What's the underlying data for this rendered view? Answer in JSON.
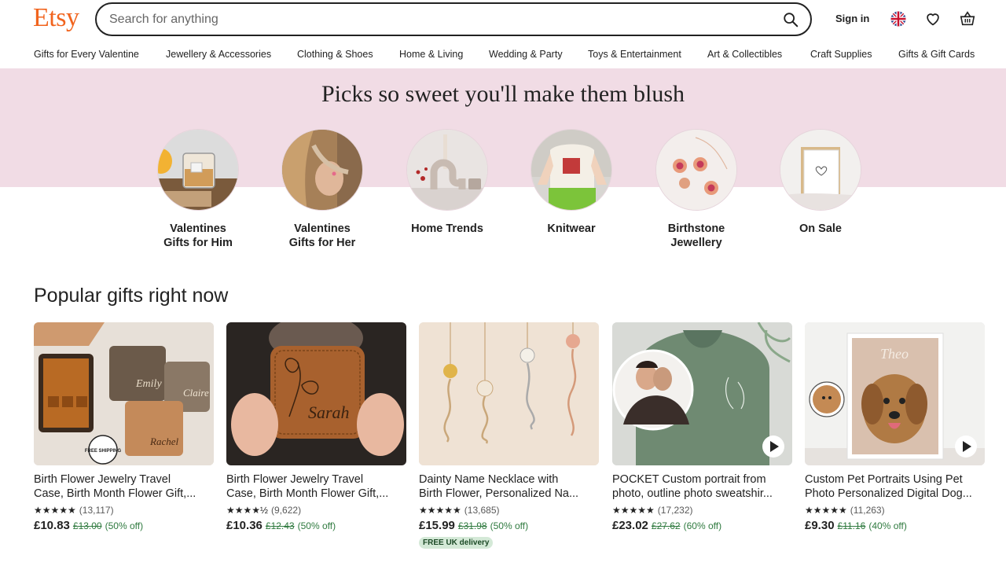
{
  "brand": {
    "logo": "Etsy",
    "color": "#F1641E"
  },
  "search": {
    "placeholder": "Search for anything",
    "value": ""
  },
  "header": {
    "sign_in": "Sign in",
    "icons": [
      "search-icon",
      "uk-flag-icon",
      "heart-icon",
      "basket-icon"
    ]
  },
  "nav": {
    "items": [
      "Gifts for Every Valentine",
      "Jewellery & Accessories",
      "Clothing & Shoes",
      "Home & Living",
      "Wedding & Party",
      "Toys & Entertainment",
      "Art & Collectibles",
      "Craft Supplies",
      "Gifts & Gift Cards"
    ]
  },
  "hero": {
    "title": "Picks so sweet you'll make them blush",
    "bg": "#f1dce5"
  },
  "categories": [
    {
      "label": "Valentines Gifts for Him"
    },
    {
      "label": "Valentines Gifts for Her"
    },
    {
      "label": "Home Trends"
    },
    {
      "label": "Knitwear"
    },
    {
      "label": "Birthstone Jewellery"
    },
    {
      "label": "On Sale"
    }
  ],
  "popular": {
    "title": "Popular gifts right now",
    "items": [
      {
        "title1": "Birth Flower Jewelry Travel",
        "title2": "Case, Birth Month Flower Gift,...",
        "stars": "★★★★★",
        "reviews": "(13,117)",
        "price": "£10.83",
        "orig": "£13.00",
        "off": "(50% off)",
        "badge": "",
        "image_text": [
          "Emily",
          "Claire",
          "Rachel"
        ],
        "free_shipping": "FREE SHIPPING"
      },
      {
        "title1": "Birth Flower Jewelry Travel",
        "title2": "Case, Birth Month Flower Gift,...",
        "stars": "★★★★½",
        "reviews": "(9,622)",
        "price": "£10.36",
        "orig": "£12.43",
        "off": "(50% off)",
        "badge": "",
        "image_text": "Sarah"
      },
      {
        "title1": "Dainty Name Necklace with",
        "title2": "Birth Flower, Personalized Na...",
        "stars": "★★★★★",
        "reviews": "(13,685)",
        "price": "£15.99",
        "orig": "£31.98",
        "off": "(50% off)",
        "badge": "FREE UK delivery"
      },
      {
        "title1": "POCKET Custom portrait from",
        "title2": "photo, outline photo sweatshir...",
        "stars": "★★★★★",
        "reviews": "(17,232)",
        "price": "£23.02",
        "orig": "£27.62",
        "off": "(60% off)",
        "badge": ""
      },
      {
        "title1": "Custom Pet Portraits Using Pet",
        "title2": "Photo Personalized Digital Dog...",
        "stars": "★★★★★",
        "reviews": "(11,263)",
        "price": "£9.30",
        "orig": "£11.16",
        "off": "(40% off)",
        "badge": "",
        "image_text": "Theo"
      }
    ]
  }
}
